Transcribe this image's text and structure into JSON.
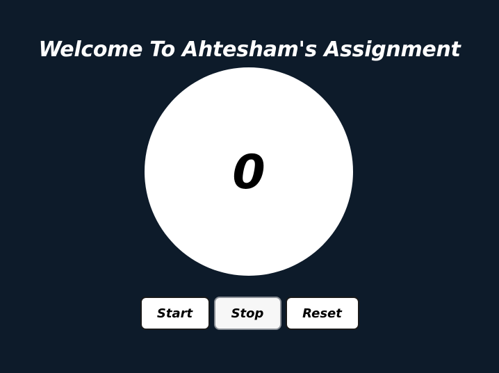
{
  "header": {
    "title": "Welcome To Ahtesham's Assignment"
  },
  "counter": {
    "value": "0"
  },
  "controls": {
    "start_label": "Start",
    "stop_label": "Stop",
    "reset_label": "Reset"
  },
  "colors": {
    "background": "#0d1b2a",
    "circle": "#ffffff",
    "title_text": "#ffffff",
    "button_bg": "#ffffff",
    "button_text": "#000000"
  }
}
